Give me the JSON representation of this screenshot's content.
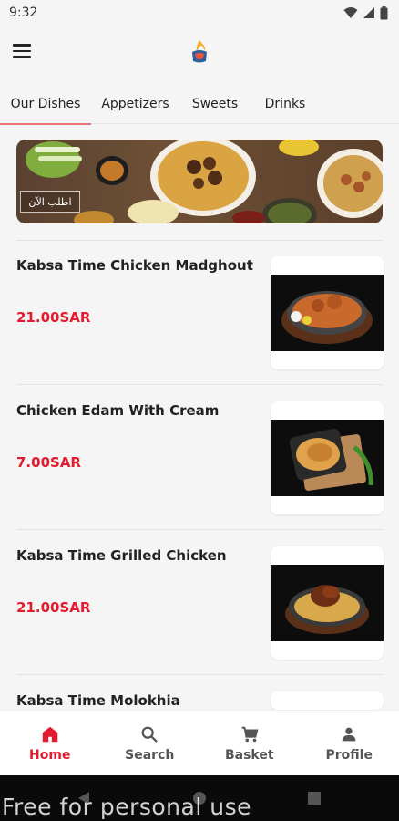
{
  "status_bar": {
    "time": "9:32"
  },
  "tabs": [
    {
      "label": "Our Dishes"
    },
    {
      "label": "Appetizers"
    },
    {
      "label": "Sweets"
    },
    {
      "label": "Drinks"
    }
  ],
  "banner": {
    "badge_text": "اطلب الآن"
  },
  "dishes": [
    {
      "name": "Kabsa Time Chicken Madghout",
      "price": "21.00SAR"
    },
    {
      "name": "Chicken Edam With Cream",
      "price": "7.00SAR"
    },
    {
      "name": "Kabsa Time Grilled Chicken",
      "price": "21.00SAR"
    },
    {
      "name": "Kabsa Time Molokhia"
    }
  ],
  "bottom_nav": [
    {
      "label": "Home",
      "icon": "home-icon"
    },
    {
      "label": "Search",
      "icon": "search-icon"
    },
    {
      "label": "Basket",
      "icon": "cart-icon"
    },
    {
      "label": "Profile",
      "icon": "person-icon"
    }
  ],
  "watermark": "Free for personal use",
  "colors": {
    "accent": "#e41b2f",
    "tab_indicator": "#e57373",
    "background": "#f5f5f5"
  }
}
